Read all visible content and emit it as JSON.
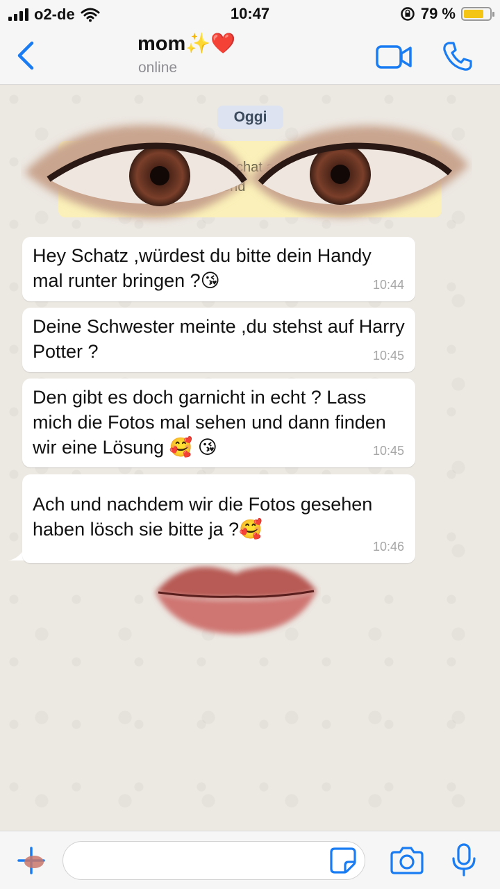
{
  "status_bar": {
    "carrier": "o2-de",
    "time": "10:47",
    "battery_text": "79 %",
    "battery_level": 0.79
  },
  "header": {
    "contact_name": "mom✨❤️",
    "contact_status": "online"
  },
  "chat": {
    "date_label": "Oggi",
    "system_note_partial": "is chat a\nend",
    "messages": [
      {
        "text": " Hey Schatz ,würdest du bitte dein Handy mal runter bringen ?😘",
        "time": "10:44"
      },
      {
        "text": "Deine Schwester  meinte ,du stehst auf Harry Potter ?",
        "time": "10:45"
      },
      {
        "text": "Den gibt es doch garnicht in echt ? Lass mich die Fotos mal sehen und dann finden wir eine Lösung 🥰 😘",
        "time": "10:45"
      },
      {
        "text": "Ach und nachdem wir die Fotos gesehen haben lösch sie bitte ja ?🥰",
        "time": "10:46"
      }
    ]
  },
  "input": {
    "placeholder": "",
    "value": ""
  },
  "colors": {
    "accent": "#1a7cf2",
    "bubble": "#ffffff",
    "chat_bg": "#ece8e2",
    "note_bg": "#fbf0b9",
    "date_pill": "#dde3f0",
    "time_text": "#a7a7a7"
  },
  "icons": [
    "wifi-icon",
    "lock-rotation-icon",
    "back-chevron-icon",
    "video-call-icon",
    "phone-icon",
    "plus-icon",
    "sticker-icon",
    "camera-icon",
    "microphone-icon"
  ]
}
